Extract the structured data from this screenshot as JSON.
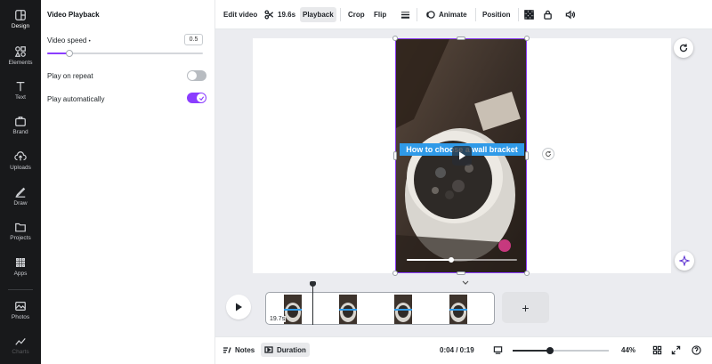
{
  "rail": {
    "items": [
      {
        "label": "Design",
        "icon": "design-icon"
      },
      {
        "label": "Elements",
        "icon": "elements-icon"
      },
      {
        "label": "Text",
        "icon": "text-icon"
      },
      {
        "label": "Brand",
        "icon": "brand-icon"
      },
      {
        "label": "Uploads",
        "icon": "uploads-icon"
      },
      {
        "label": "Draw",
        "icon": "draw-icon"
      },
      {
        "label": "Projects",
        "icon": "projects-icon"
      },
      {
        "label": "Apps",
        "icon": "apps-icon"
      },
      {
        "label": "Photos",
        "icon": "photos-icon"
      },
      {
        "label": "Charts",
        "icon": "charts-icon"
      }
    ]
  },
  "panel": {
    "title": "Video Playback",
    "speed_label": "Video speed",
    "speed_value": "0.5",
    "speed_fraction": 0.14,
    "repeat_label": "Play on repeat",
    "repeat_on": false,
    "auto_label": "Play automatically",
    "auto_on": true
  },
  "toolbar": {
    "edit_video": "Edit video",
    "duration": "19.6s",
    "playback": "Playback",
    "crop": "Crop",
    "flip": "Flip",
    "animate": "Animate",
    "position": "Position"
  },
  "canvas": {
    "caption": "How to choose a wall bracket",
    "video_progress": 0.4
  },
  "timeline": {
    "clip_duration": "19.7s"
  },
  "bottom": {
    "notes": "Notes",
    "duration": "Duration",
    "time": "0:04 / 0:19",
    "zoom": "44%",
    "zoom_fraction": 0.39
  },
  "colors": {
    "accent": "#8b3dff",
    "caption_bg": "#2f9ae8",
    "rail_bg": "#18191b"
  }
}
